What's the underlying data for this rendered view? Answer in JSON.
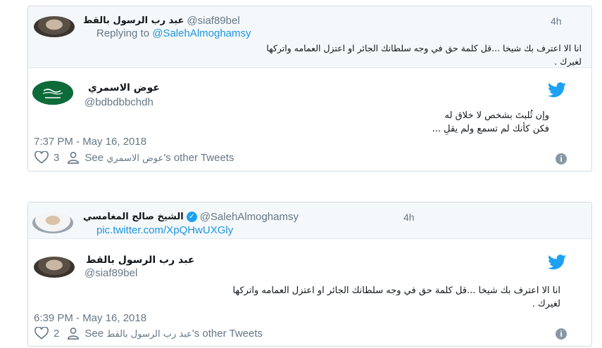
{
  "card1": {
    "parent": {
      "name": "عبد رب الرسول بالقط",
      "handle": "@siaf89bel",
      "time": "4h",
      "replying_prefix": "Replying to ",
      "replying_handle": "@SalehAlmoghamsy",
      "text_line1": "انا الا اعترف بك شيخا ...قل كلمة حق في وجه سلطانك الجائر او اعتزل العمامه واتركها",
      "text_line2": "لغيرك ."
    },
    "tweet": {
      "name": "عوض الاسمري",
      "handle": "@bdbdbbchdh",
      "text_line1": "وإن ثُلبتَ بشخص لا خلاق له",
      "text_line2": "فكن كأنك لم تسمع ولم يقلِ ...",
      "timestamp": "7:37 PM - May 16, 2018",
      "likes": "3",
      "see_prefix": "See ",
      "see_name": "عوض الاسمري",
      "see_suffix": "'s other Tweets"
    }
  },
  "card2": {
    "parent": {
      "name": "الشيخ صالح المغامسي",
      "handle": "@SalehAlmoghamsy",
      "time": "4h",
      "link": "pic.twitter.com/XpQHwUXGly"
    },
    "tweet": {
      "name": "عبد رب الرسول بالقط",
      "handle": "@siaf89bel",
      "text_line1": "انا الا اعترف بك شيخا ...قل كلمة حق في وجه سلطانك الجائر او اعتزل العمامه واتركها",
      "text_line2": "لغيرك .",
      "timestamp": "6:39 PM - May 16, 2018",
      "likes": "2",
      "see_prefix": "See ",
      "see_name": "عبد رب الرسول بالقط",
      "see_suffix": "'s other Tweets"
    }
  },
  "icons": {
    "twitter": "twitter-bird-icon",
    "heart": "heart-icon",
    "person": "person-icon",
    "info": "info-icon",
    "verified": "verified-badge-icon"
  },
  "colors": {
    "twitter_blue": "#1da1f2",
    "link_blue": "#1b95e0",
    "muted": "#657786"
  }
}
